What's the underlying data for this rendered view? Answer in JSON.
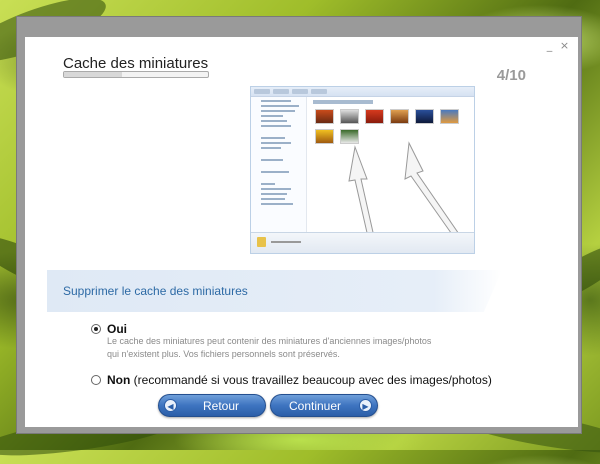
{
  "window": {
    "minimize_label": "_",
    "close_label": "×"
  },
  "header": {
    "title": "Cache des miniatures",
    "step": "4/10",
    "progress": 0.4
  },
  "section": {
    "title": "Supprimer le cache des miniatures"
  },
  "options": {
    "yes_label": "Oui",
    "yes_description_line1": "Le cache des miniatures peut contenir des miniatures d'anciennes images/photos",
    "yes_description_line2": "qui n'existent plus. Vos fichiers personnels sont préservés.",
    "no_label": "Non",
    "no_hint": " (recommandé si vous travaillez beaucoup avec des images/photos)",
    "selected": "yes"
  },
  "buttons": {
    "back_label": "Retour",
    "back_icon": "arrow-left-icon",
    "next_label": "Continuer",
    "next_icon": "arrow-right-icon"
  },
  "colors": {
    "accent": "#2d6aa5",
    "button": "#3e74c0"
  }
}
